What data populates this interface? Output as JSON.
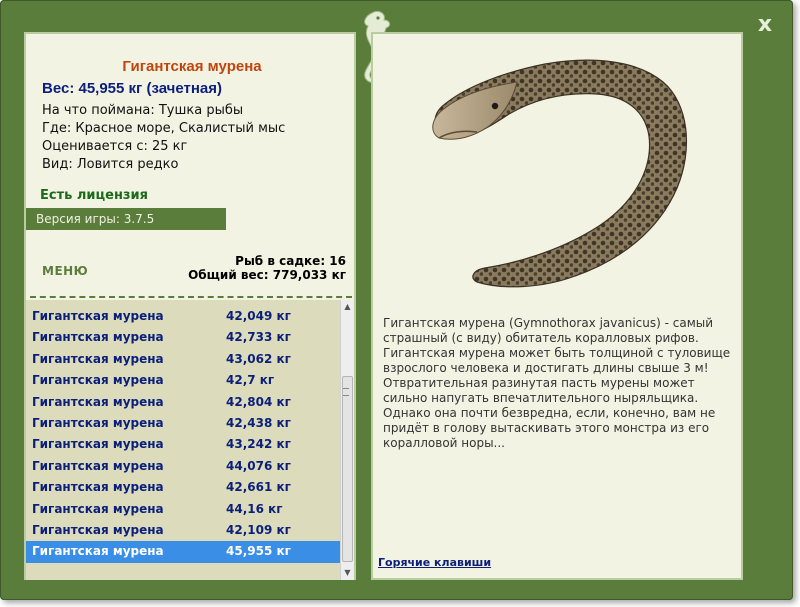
{
  "window": {
    "close_label": "x"
  },
  "fish": {
    "title": "Гигантская мурена",
    "weight": "Вес: 45,955 кг (зачетная)",
    "info": [
      "На что поймана: Тушка рыбы",
      "Где: Красное море, Скалистый мыс",
      "Оценивается с: 25 кг",
      "Вид: Ловится редко"
    ],
    "license": "Есть лицензия",
    "version": "Версия игры: 3.7.5",
    "description": "Гигантская мурена (Gymnothorax javanicus) - самый страшный (с виду) обитатель коралловых рифов. Гигантская мурена может быть толщиной с туловище взрослого человека и достигать длины свыше 3 м! Отвратительная разинутая пасть мурены может сильно напугать впечатлительного ныряльщика. Однако она почти безвредна, если, конечно, вам не придёт в голову вытаскивать этого монстра из его коралловой норы..."
  },
  "menu_label": "МЕНЮ",
  "stats": {
    "count": "Рыб в садке: 16",
    "total": "Общий вес: 779,033 кг"
  },
  "catch_list": [
    {
      "name": "Гигантская мурена",
      "weight": "42,049 кг"
    },
    {
      "name": "Гигантская мурена",
      "weight": "42,733 кг"
    },
    {
      "name": "Гигантская мурена",
      "weight": "43,062 кг"
    },
    {
      "name": "Гигантская мурена",
      "weight": "42,7 кг"
    },
    {
      "name": "Гигантская мурена",
      "weight": "42,804 кг"
    },
    {
      "name": "Гигантская мурена",
      "weight": "42,438 кг"
    },
    {
      "name": "Гигантская мурена",
      "weight": "43,242 кг"
    },
    {
      "name": "Гигантская мурена",
      "weight": "44,076 кг"
    },
    {
      "name": "Гигантская мурена",
      "weight": "42,661 кг"
    },
    {
      "name": "Гигантская мурена",
      "weight": "44,16 кг"
    },
    {
      "name": "Гигантская мурена",
      "weight": "42,109 кг"
    },
    {
      "name": "Гигантская мурена",
      "weight": "45,955 кг",
      "selected": true
    }
  ],
  "hotkeys_label": "Горячие клавиши",
  "colors": {
    "frame": "#5b7d3c",
    "panel": "#f3f3e4",
    "title": "#c0460d",
    "text_blue": "#0b1f7a",
    "selected": "#3a8ee6",
    "list_bg": "#dcdcbc"
  }
}
